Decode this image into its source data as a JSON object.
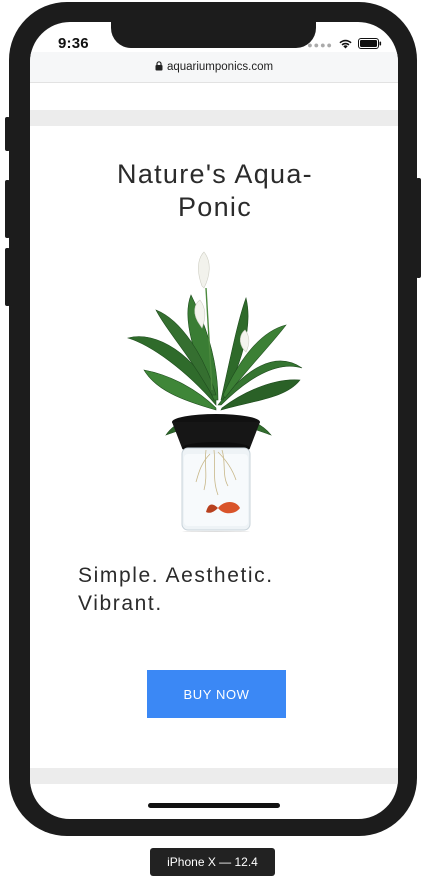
{
  "status_bar": {
    "time": "9:36",
    "signal_icon": "cellular-dots-icon",
    "wifi_icon": "wifi-icon",
    "battery_icon": "battery-icon"
  },
  "browser": {
    "url": "aquariumponics.com",
    "lock_icon": "lock-icon"
  },
  "hero": {
    "title": "Nature's Aqua-Ponic",
    "product_image": "plant-aquarium-product-image",
    "tagline": "Simple. Aesthetic. Vibrant.",
    "cta_label": "BUY NOW"
  },
  "device": {
    "label": "iPhone X — 12.4"
  },
  "colors": {
    "cta_background": "#3b88f5",
    "frame": "#1c1c1c",
    "band": "#ececec"
  }
}
